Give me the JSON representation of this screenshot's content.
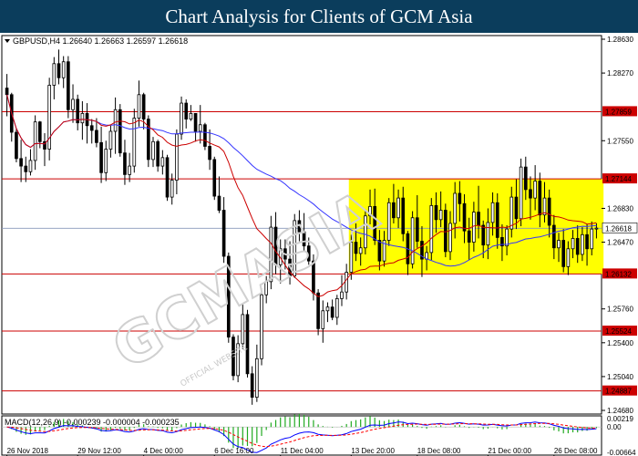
{
  "header": {
    "title": "Chart Analysis for Clients of GCM Asia"
  },
  "watermark": {
    "text": "GCMASIA",
    "subtitle": "OFFICIAL WEBSITE",
    "color": "#d0d0d0"
  },
  "chart_data": [
    {
      "type": "candlestick",
      "symbol_line": "GBPUSD,H4  1.26640 1.26663 1.26597 1.26618",
      "ylim": [
        1.2468,
        1.2863
      ],
      "y_ticks": [
        "1.28630",
        "1.28270",
        "1.27550",
        "1.26830",
        "1.26470",
        "1.25760",
        "1.25400",
        "1.25040",
        "1.24680"
      ],
      "x_ticks": [
        "26 Nov 2018",
        "29 Nov 12:00",
        "4 Dec 00:00",
        "6 Dec 16:00",
        "11 Dec 04:00",
        "13 Dec 20:00",
        "18 Dec 08:00",
        "21 Dec 00:00",
        "26 Dec 08:00"
      ],
      "current_price": {
        "value": 1.26618,
        "label": "1.26618"
      },
      "horizontal_levels": [
        {
          "value": 1.27859,
          "label": "1.27859"
        },
        {
          "value": 1.27144,
          "label": "1.27144"
        },
        {
          "value": 1.26132,
          "label": "1.26132"
        },
        {
          "value": 1.25524,
          "label": "1.25524"
        },
        {
          "value": 1.24887,
          "label": "1.24887"
        }
      ],
      "consolidation_box": {
        "x_start_index": 73,
        "x_end_index": 126,
        "y_top": 1.27144,
        "y_bottom": 1.26132,
        "color": "#ffff00"
      },
      "moving_averages": [
        {
          "period": 50,
          "color": "#3333ff"
        },
        {
          "period": 20,
          "color": "#cc0000"
        }
      ],
      "ohlc": [
        [
          1.2811,
          1.2826,
          1.2781,
          1.2804
        ],
        [
          1.2804,
          1.2806,
          1.2754,
          1.2764
        ],
        [
          1.2764,
          1.2768,
          1.2732,
          1.2736
        ],
        [
          1.2736,
          1.2756,
          1.2711,
          1.2728
        ],
        [
          1.2728,
          1.2738,
          1.2711,
          1.2722
        ],
        [
          1.2722,
          1.2746,
          1.2718,
          1.2734
        ],
        [
          1.2734,
          1.2782,
          1.2724,
          1.2775
        ],
        [
          1.2775,
          1.2776,
          1.2747,
          1.2754
        ],
        [
          1.2754,
          1.2763,
          1.2728,
          1.2746
        ],
        [
          1.2746,
          1.2822,
          1.2734,
          1.2814
        ],
        [
          1.2814,
          1.2844,
          1.2799,
          1.2837
        ],
        [
          1.2837,
          1.2852,
          1.2815,
          1.2822
        ],
        [
          1.2822,
          1.2845,
          1.2811,
          1.2839
        ],
        [
          1.2839,
          1.2845,
          1.2779,
          1.2788
        ],
        [
          1.2788,
          1.2815,
          1.2774,
          1.2799
        ],
        [
          1.2799,
          1.2804,
          1.2766,
          1.2774
        ],
        [
          1.2774,
          1.2797,
          1.2756,
          1.2784
        ],
        [
          1.2784,
          1.2795,
          1.2752,
          1.2771
        ],
        [
          1.2771,
          1.2778,
          1.2752,
          1.2766
        ],
        [
          1.2766,
          1.2779,
          1.2748,
          1.2753
        ],
        [
          1.2753,
          1.277,
          1.271,
          1.2721
        ],
        [
          1.2721,
          1.2755,
          1.2712,
          1.2746
        ],
        [
          1.2746,
          1.2771,
          1.2737,
          1.2765
        ],
        [
          1.2765,
          1.2801,
          1.2741,
          1.2788
        ],
        [
          1.2788,
          1.2794,
          1.2738,
          1.2742
        ],
        [
          1.2742,
          1.2756,
          1.2708,
          1.2719
        ],
        [
          1.2719,
          1.2742,
          1.2711,
          1.2728
        ],
        [
          1.2728,
          1.2789,
          1.2721,
          1.2779
        ],
        [
          1.2779,
          1.2819,
          1.277,
          1.2804
        ],
        [
          1.2804,
          1.2806,
          1.2767,
          1.2778
        ],
        [
          1.2778,
          1.2782,
          1.2727,
          1.2735
        ],
        [
          1.2735,
          1.2759,
          1.2727,
          1.2754
        ],
        [
          1.2754,
          1.2756,
          1.2722,
          1.2728
        ],
        [
          1.2728,
          1.2745,
          1.2719,
          1.2737
        ],
        [
          1.2737,
          1.274,
          1.2691,
          1.2695
        ],
        [
          1.2695,
          1.272,
          1.2687,
          1.2713
        ],
        [
          1.2713,
          1.2767,
          1.2698,
          1.2762
        ],
        [
          1.2762,
          1.2802,
          1.2756,
          1.2795
        ],
        [
          1.2795,
          1.2799,
          1.2768,
          1.2778
        ],
        [
          1.2778,
          1.2793,
          1.2776,
          1.2784
        ],
        [
          1.2784,
          1.2784,
          1.2754,
          1.2765
        ],
        [
          1.2765,
          1.2793,
          1.2752,
          1.2772
        ],
        [
          1.2772,
          1.2774,
          1.2745,
          1.2749
        ],
        [
          1.2749,
          1.2767,
          1.2724,
          1.2735
        ],
        [
          1.2735,
          1.2738,
          1.2692,
          1.2696
        ],
        [
          1.2696,
          1.2717,
          1.2678,
          1.2681
        ],
        [
          1.2681,
          1.2695,
          1.2625,
          1.2632
        ],
        [
          1.2632,
          1.2636,
          1.254,
          1.2546
        ],
        [
          1.2546,
          1.2549,
          1.25,
          1.2505
        ],
        [
          1.2505,
          1.2548,
          1.2498,
          1.2539
        ],
        [
          1.2539,
          1.2582,
          1.2533,
          1.257
        ],
        [
          1.257,
          1.2575,
          1.2503,
          1.2507
        ],
        [
          1.2507,
          1.2515,
          1.2474,
          1.2482
        ],
        [
          1.2482,
          1.2538,
          1.2477,
          1.2523
        ],
        [
          1.2523,
          1.2598,
          1.2516,
          1.2591
        ],
        [
          1.2591,
          1.2611,
          1.2582,
          1.2605
        ],
        [
          1.2605,
          1.2675,
          1.2597,
          1.2663
        ],
        [
          1.2663,
          1.2679,
          1.2613,
          1.2623
        ],
        [
          1.2623,
          1.265,
          1.2603,
          1.264
        ],
        [
          1.264,
          1.265,
          1.2618,
          1.2629
        ],
        [
          1.2629,
          1.2648,
          1.2602,
          1.2611
        ],
        [
          1.2611,
          1.2677,
          1.2609,
          1.267
        ],
        [
          1.267,
          1.2681,
          1.2648,
          1.2658
        ],
        [
          1.2658,
          1.2678,
          1.2637,
          1.2643
        ],
        [
          1.2643,
          1.2652,
          1.2623,
          1.2627
        ],
        [
          1.2627,
          1.2634,
          1.2585,
          1.2593
        ],
        [
          1.2593,
          1.2597,
          1.2548,
          1.2555
        ],
        [
          1.2555,
          1.2585,
          1.254,
          1.2574
        ],
        [
          1.2574,
          1.2583,
          1.2562,
          1.2578
        ],
        [
          1.2578,
          1.2586,
          1.2564,
          1.2567
        ],
        [
          1.2567,
          1.2591,
          1.2559,
          1.2587
        ],
        [
          1.2587,
          1.2612,
          1.2579,
          1.2594
        ],
        [
          1.2594,
          1.2624,
          1.2586,
          1.2615
        ],
        [
          1.2615,
          1.2655,
          1.2607,
          1.2647
        ],
        [
          1.2647,
          1.2667,
          1.2627,
          1.2635
        ],
        [
          1.2635,
          1.2652,
          1.2622,
          1.2641
        ],
        [
          1.2641,
          1.2682,
          1.2634,
          1.2675
        ],
        [
          1.2675,
          1.2703,
          1.2666,
          1.2685
        ],
        [
          1.2685,
          1.2704,
          1.2644,
          1.2649
        ],
        [
          1.2649,
          1.266,
          1.2617,
          1.2627
        ],
        [
          1.2627,
          1.2659,
          1.2621,
          1.2649
        ],
        [
          1.2649,
          1.2694,
          1.2643,
          1.2689
        ],
        [
          1.2689,
          1.2709,
          1.2667,
          1.2673
        ],
        [
          1.2673,
          1.2703,
          1.2662,
          1.2694
        ],
        [
          1.2694,
          1.2706,
          1.2648,
          1.2656
        ],
        [
          1.2656,
          1.2659,
          1.2612,
          1.2624
        ],
        [
          1.2624,
          1.268,
          1.2619,
          1.2673
        ],
        [
          1.2673,
          1.2697,
          1.2641,
          1.2648
        ],
        [
          1.2648,
          1.2664,
          1.261,
          1.2629
        ],
        [
          1.2629,
          1.2643,
          1.2617,
          1.2636
        ],
        [
          1.2636,
          1.2694,
          1.2628,
          1.2686
        ],
        [
          1.2686,
          1.27,
          1.2657,
          1.2671
        ],
        [
          1.2671,
          1.2701,
          1.2663,
          1.2681
        ],
        [
          1.2681,
          1.2688,
          1.2631,
          1.2637
        ],
        [
          1.2637,
          1.268,
          1.2628,
          1.2667
        ],
        [
          1.2667,
          1.2711,
          1.2651,
          1.2699
        ],
        [
          1.2699,
          1.2712,
          1.2669,
          1.2688
        ],
        [
          1.2688,
          1.2698,
          1.2646,
          1.2659
        ],
        [
          1.2659,
          1.2673,
          1.2628,
          1.2647
        ],
        [
          1.2647,
          1.269,
          1.2637,
          1.2679
        ],
        [
          1.2679,
          1.2707,
          1.2651,
          1.2665
        ],
        [
          1.2665,
          1.267,
          1.263,
          1.2644
        ],
        [
          1.2644,
          1.2683,
          1.2629,
          1.2668
        ],
        [
          1.2668,
          1.27,
          1.2654,
          1.2689
        ],
        [
          1.2689,
          1.2699,
          1.264,
          1.2652
        ],
        [
          1.2652,
          1.2666,
          1.2627,
          1.2643
        ],
        [
          1.2643,
          1.2665,
          1.2633,
          1.2661
        ],
        [
          1.2661,
          1.2706,
          1.2652,
          1.2695
        ],
        [
          1.2695,
          1.2714,
          1.2661,
          1.2672
        ],
        [
          1.2672,
          1.2736,
          1.2664,
          1.2727
        ],
        [
          1.2727,
          1.2738,
          1.2692,
          1.2703
        ],
        [
          1.2703,
          1.2717,
          1.2671,
          1.2694
        ],
        [
          1.2694,
          1.2729,
          1.2681,
          1.2712
        ],
        [
          1.2712,
          1.2721,
          1.2663,
          1.2676
        ],
        [
          1.2676,
          1.2711,
          1.2668,
          1.2694
        ],
        [
          1.2694,
          1.2703,
          1.2652,
          1.2665
        ],
        [
          1.2665,
          1.2676,
          1.2629,
          1.2641
        ],
        [
          1.2641,
          1.2657,
          1.2626,
          1.2649
        ],
        [
          1.2649,
          1.2661,
          1.2615,
          1.2621
        ],
        [
          1.2621,
          1.2648,
          1.2612,
          1.264
        ],
        [
          1.264,
          1.266,
          1.263,
          1.2651
        ],
        [
          1.2651,
          1.2665,
          1.2625,
          1.2634
        ],
        [
          1.2634,
          1.2663,
          1.2627,
          1.2655
        ],
        [
          1.2655,
          1.2666,
          1.2622,
          1.264
        ],
        [
          1.264,
          1.2669,
          1.2633,
          1.2661
        ],
        [
          1.2661,
          1.2667,
          1.2651,
          1.2662
        ]
      ]
    },
    {
      "type": "line",
      "title": "MACD(12,26,9) -0.000239 -0.000004 -0.000235",
      "y_ticks": [
        "0.00219",
        "0.00",
        "-0.00664"
      ],
      "ylim": [
        -0.00664,
        0.00219
      ]
    }
  ]
}
